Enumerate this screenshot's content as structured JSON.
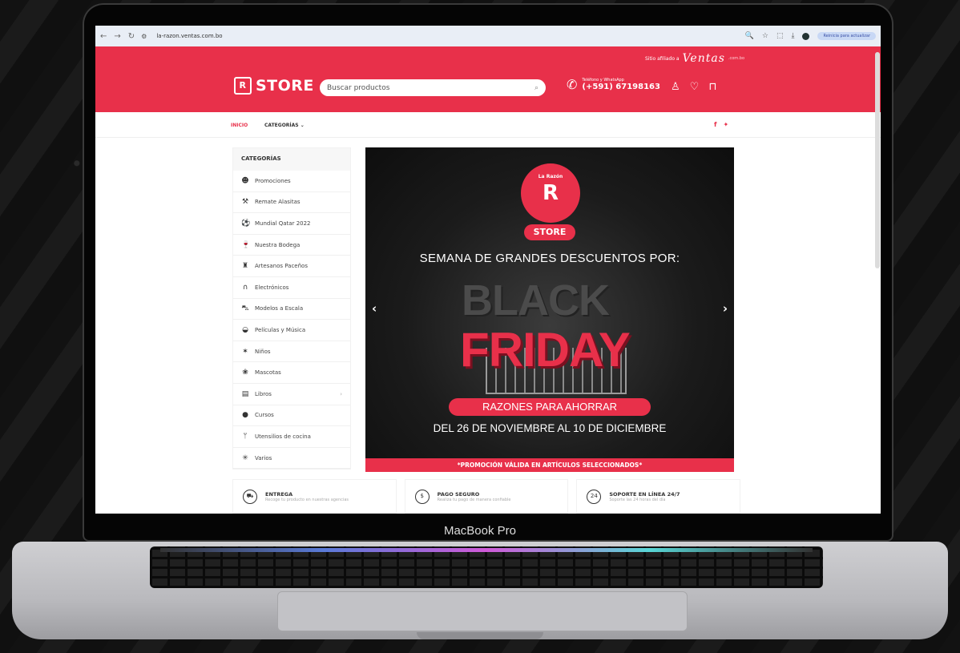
{
  "device": {
    "label": "MacBook Pro"
  },
  "browser": {
    "url": "la-razon.ventas.com.bo",
    "reload_button": "Reinicia para actualizar"
  },
  "header": {
    "sitio_afiliado": "Sitio afiliado a",
    "ventas_brand": "Ventas",
    "ventas_domain": ".com.bo",
    "logo_text": "STORE",
    "search_placeholder": "Buscar productos",
    "phone_label": "Teléfono y WhatsApp",
    "phone_number": "(+591) 67198163"
  },
  "topnav": {
    "inicio": "INICIO",
    "categorias": "CATEGORÍAS ⌄"
  },
  "sidebar": {
    "title": "CATEGORÍAS",
    "items": [
      {
        "label": "Promociones",
        "icon": "users-icon"
      },
      {
        "label": "Remate Alasitas",
        "icon": "hammer-icon"
      },
      {
        "label": "Mundial Qatar 2022",
        "icon": "soccer-ball-icon"
      },
      {
        "label": "Nuestra Bodega",
        "icon": "wine-icon"
      },
      {
        "label": "Artesanos Paceños",
        "icon": "figure-icon"
      },
      {
        "label": "Electrónicos",
        "icon": "headphones-icon"
      },
      {
        "label": "Modelos a Escala",
        "icon": "car-icon"
      },
      {
        "label": "Películas y Música",
        "icon": "disc-icon"
      },
      {
        "label": "Niños",
        "icon": "child-icon"
      },
      {
        "label": "Mascotas",
        "icon": "paw-icon"
      },
      {
        "label": "Libros",
        "icon": "book-icon"
      },
      {
        "label": "Cursos",
        "icon": "course-icon"
      },
      {
        "label": "Utensilios de cocina",
        "icon": "cutlery-icon"
      },
      {
        "label": "Varios",
        "icon": "asterisk-icon"
      }
    ]
  },
  "banner": {
    "badge_small": "La Razón",
    "badge_letter": "R",
    "store_pill": "STORE",
    "headline": "SEMANA DE GRANDES DESCUENTOS POR:",
    "black": "BLACK",
    "friday": "FRIDAY",
    "razones": "RAZONES PARA AHORRAR",
    "fechas": "DEL 26 DE NOVIEMBRE AL 10 DE DICIEMBRE",
    "promo": "*PROMOCIÓN VÁLIDA EN ARTÍCULOS SELECCIONADOS*"
  },
  "features": [
    {
      "title": "ENTREGA",
      "subtitle": "Recoge tu producto en nuestras agencias",
      "icon": "truck-icon"
    },
    {
      "title": "PAGO SEGURO",
      "subtitle": "Realiza tu pago de manera confiable",
      "icon": "dollar-icon"
    },
    {
      "title": "SOPORTE EN LÍNEA 24/7",
      "subtitle": "Soporte las 24 horas del día",
      "icon": "support-24-icon"
    }
  ],
  "colors": {
    "accent": "#e8304a",
    "dark": "#111111"
  }
}
